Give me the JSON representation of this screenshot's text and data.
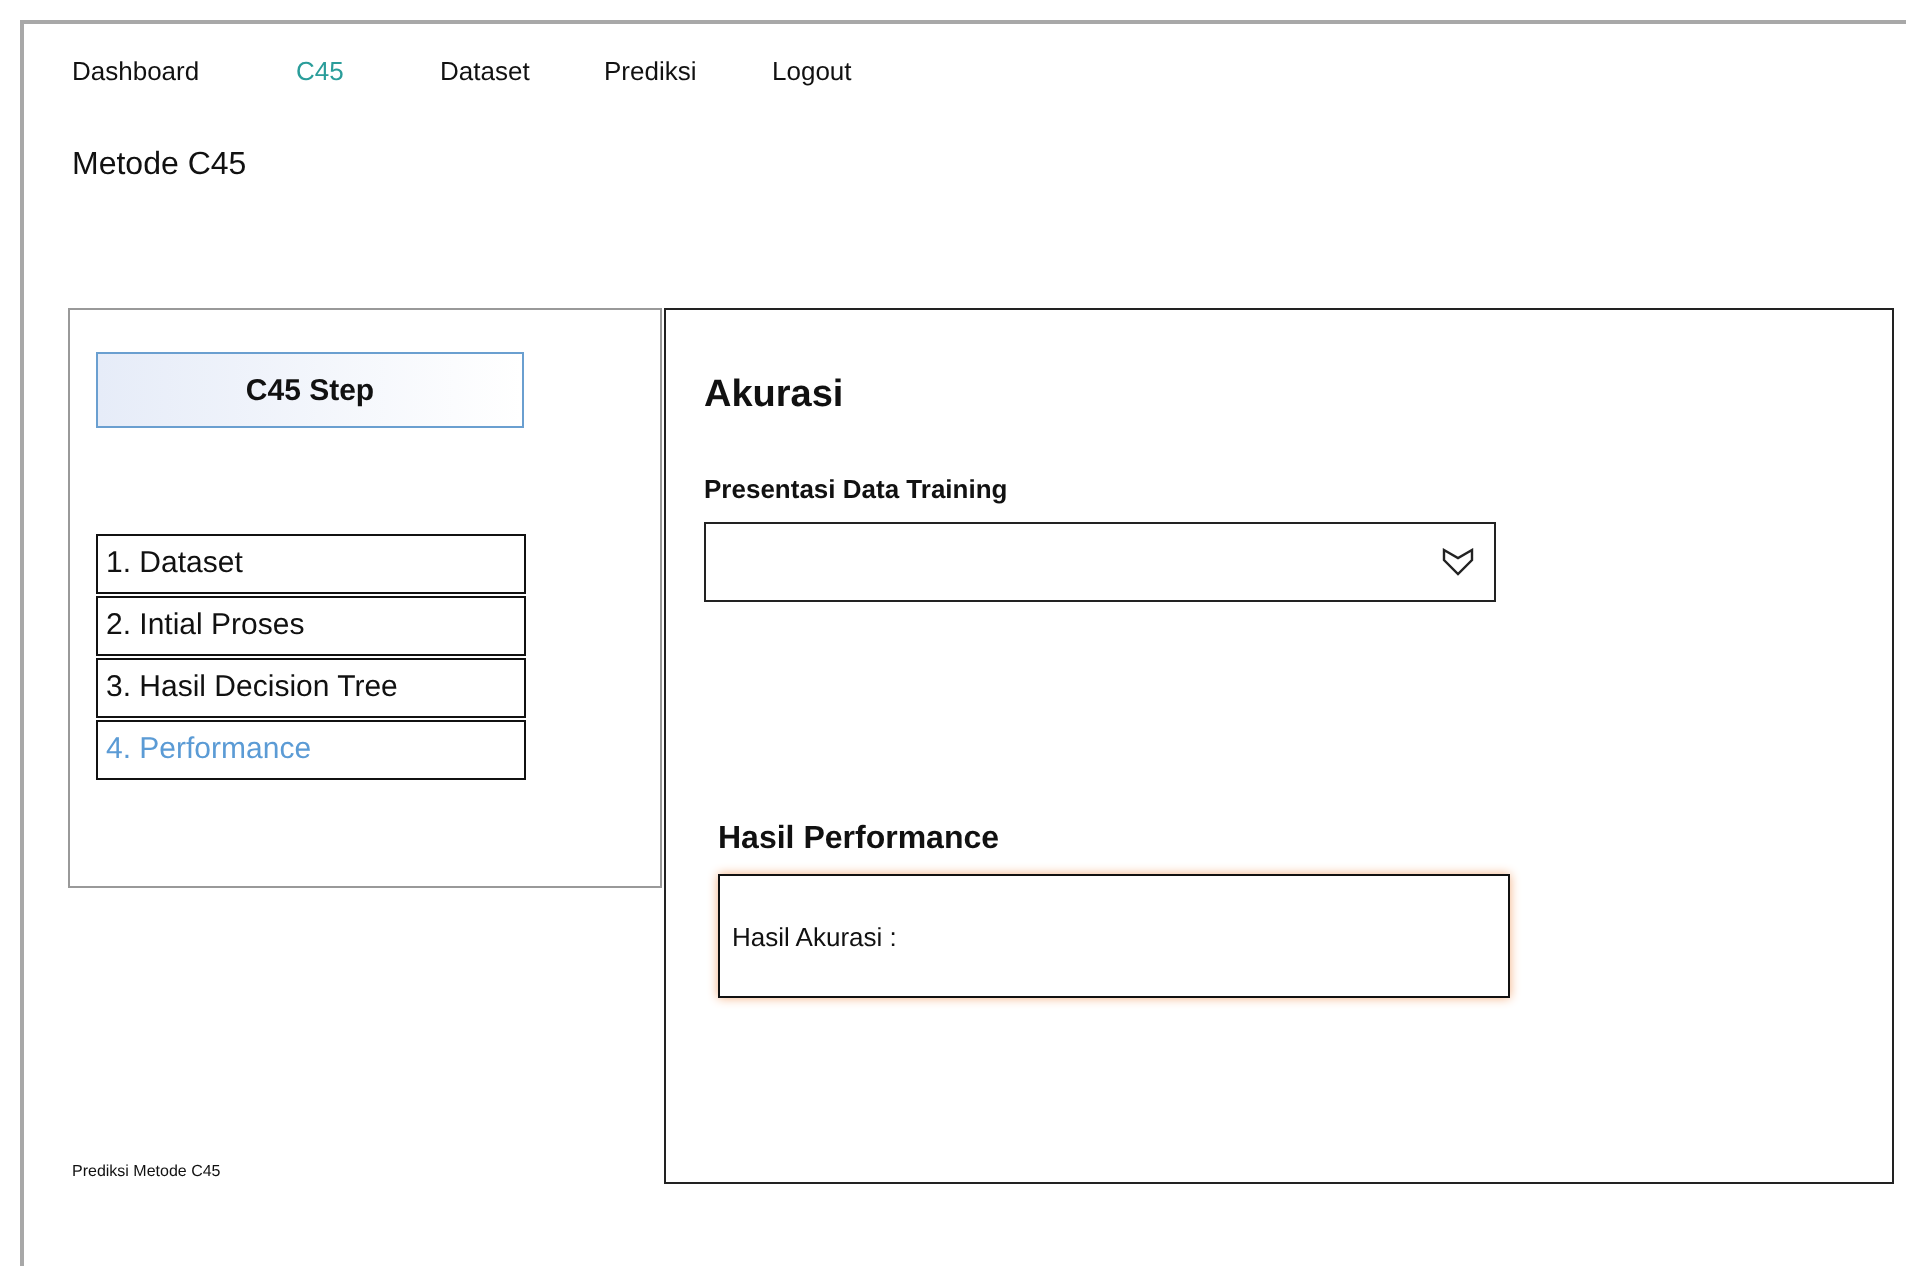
{
  "nav": [
    {
      "label": "Dashboard",
      "selected": false
    },
    {
      "label": "C45",
      "selected": true
    },
    {
      "label": "Dataset",
      "selected": false
    },
    {
      "label": "Prediksi",
      "selected": false
    },
    {
      "label": "Logout",
      "selected": false
    }
  ],
  "page_title": "Metode C45",
  "sidebar": {
    "header": "C45 Step",
    "items": [
      {
        "label": "1. Dataset",
        "selected": false
      },
      {
        "label": "2. Intial Proses",
        "selected": false
      },
      {
        "label": "3. Hasil Decision Tree",
        "selected": false
      },
      {
        "label": "4. Performance",
        "selected": true
      }
    ]
  },
  "footer": "Prediksi Metode C45",
  "main": {
    "title": "Akurasi",
    "dropdown_label": "Presentasi Data Training",
    "result_title": "Hasil Performance",
    "result_text": "Hasil Akurasi :"
  }
}
